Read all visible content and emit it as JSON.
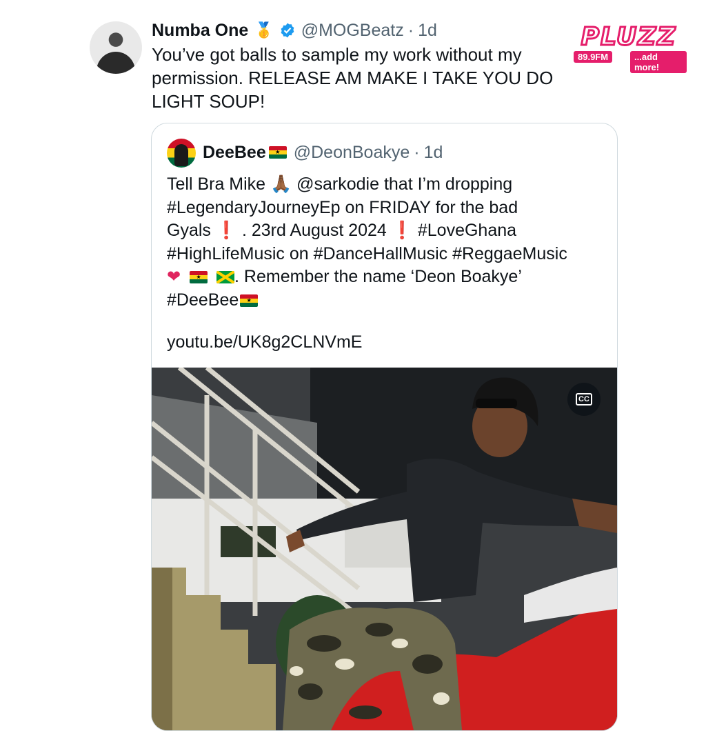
{
  "tweet": {
    "author_name": "Numba One",
    "medal_emoji": "🥇",
    "handle": "@MOGBeatz",
    "separator": "·",
    "time": "1d",
    "text": "You’ve got balls to sample my work without my permission. RELEASE AM MAKE I TAKE YOU DO LIGHT SOUP!"
  },
  "watermark": {
    "brand": "PLUZZ",
    "frequency": "89.9FM",
    "tagline": "...add more!",
    "color": "#e51e6b"
  },
  "quoted": {
    "author_name": "DeeBee",
    "handle": "@DeonBoakye",
    "separator": "·",
    "time": "1d",
    "lines": {
      "l1a": "Tell Bra Mike ",
      "l1_emoji": "🙏🏾",
      "l1b": " @sarkodie that I’m dropping",
      "l2": "#LegendaryJourneyEp on FRIDAY  for the bad",
      "l3a": "Gyals ",
      "l3_excl1": "❗",
      "l3b": " . 23rd August 2024  ",
      "l3_excl2": "❗",
      "l3c": " #LoveGhana",
      "l4": "#HighLifeMusic on #DanceHallMusic #ReggaeMusic",
      "l5_heart": "❤",
      "l5_text": ".  Remember the name ‘Deon Boakye’",
      "l6": "#DeeBee"
    },
    "link": "youtu.be/UK8g2CLNVmE",
    "media": {
      "cc_label": "CC"
    }
  },
  "colors": {
    "text": "#0f1419",
    "secondary": "#536471",
    "border": "#cfd9de",
    "verified": "#1d9bf0"
  }
}
